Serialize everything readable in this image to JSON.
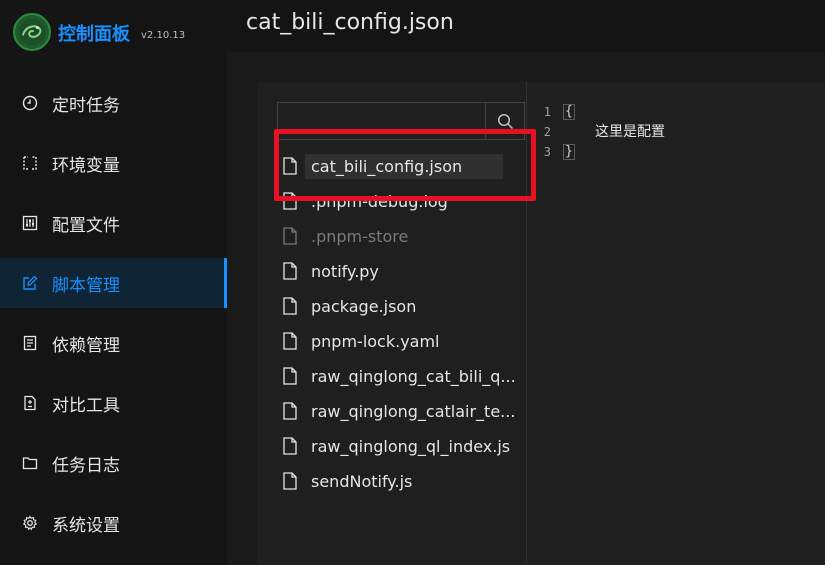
{
  "app": {
    "brand": "控制面板",
    "version": "v2.10.13"
  },
  "colors": {
    "accent": "#1890ff",
    "highlight": "#e81123",
    "sidebar_bg": "#141414"
  },
  "sidebar": {
    "items": [
      {
        "label": "定时任务",
        "icon": "clock-icon"
      },
      {
        "label": "环境变量",
        "icon": "variable-icon"
      },
      {
        "label": "配置文件",
        "icon": "sliders-icon"
      },
      {
        "label": "脚本管理",
        "icon": "edit-icon",
        "active": true
      },
      {
        "label": "依赖管理",
        "icon": "package-icon"
      },
      {
        "label": "对比工具",
        "icon": "diff-icon"
      },
      {
        "label": "任务日志",
        "icon": "folder-icon"
      },
      {
        "label": "系统设置",
        "icon": "gear-icon"
      }
    ]
  },
  "header": {
    "title": "cat_bili_config.json"
  },
  "search": {
    "value": "",
    "icon": "search-icon"
  },
  "files": [
    {
      "name": "cat_bili_config.json",
      "selected": true
    },
    {
      "name": ".pnpm-debug.log"
    },
    {
      "name": ".pnpm-store",
      "dim": true
    },
    {
      "name": "notify.py"
    },
    {
      "name": "package.json"
    },
    {
      "name": "pnpm-lock.yaml"
    },
    {
      "name": "raw_qinglong_cat_bili_q..."
    },
    {
      "name": "raw_qinglong_catlair_te..."
    },
    {
      "name": "raw_qinglong_ql_index.js"
    },
    {
      "name": "sendNotify.js"
    }
  ],
  "editor": {
    "lines": [
      {
        "num": "1",
        "text": "{"
      },
      {
        "num": "2",
        "text": ""
      },
      {
        "num": "3",
        "text": "}"
      }
    ],
    "content_text": "这里是配置"
  }
}
